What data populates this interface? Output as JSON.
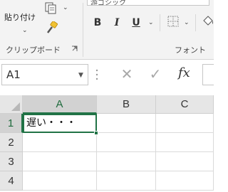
{
  "ribbon": {
    "clipboard": {
      "paste_label": "貼り付け",
      "group_label": "クリップボード"
    },
    "font": {
      "font_name_value": "游ゴシック",
      "bold_label": "B",
      "italic_label": "I",
      "underline_label": "U",
      "group_label": "フォント"
    }
  },
  "formula_bar": {
    "name_box_value": "A1",
    "cancel_symbol": "✕",
    "enter_symbol": "✓",
    "fx_label": "fx",
    "formula_value": ""
  },
  "grid": {
    "columns": [
      "A",
      "B",
      "C"
    ],
    "rows": [
      "1",
      "2",
      "3",
      "4"
    ],
    "active_column": "A",
    "active_row": "1",
    "cells": {
      "A1": "遅い・・・"
    }
  },
  "colors": {
    "accent": "#217346",
    "ribbon_bg": "#f3f3f3",
    "header_bg": "#e6e6e6"
  }
}
